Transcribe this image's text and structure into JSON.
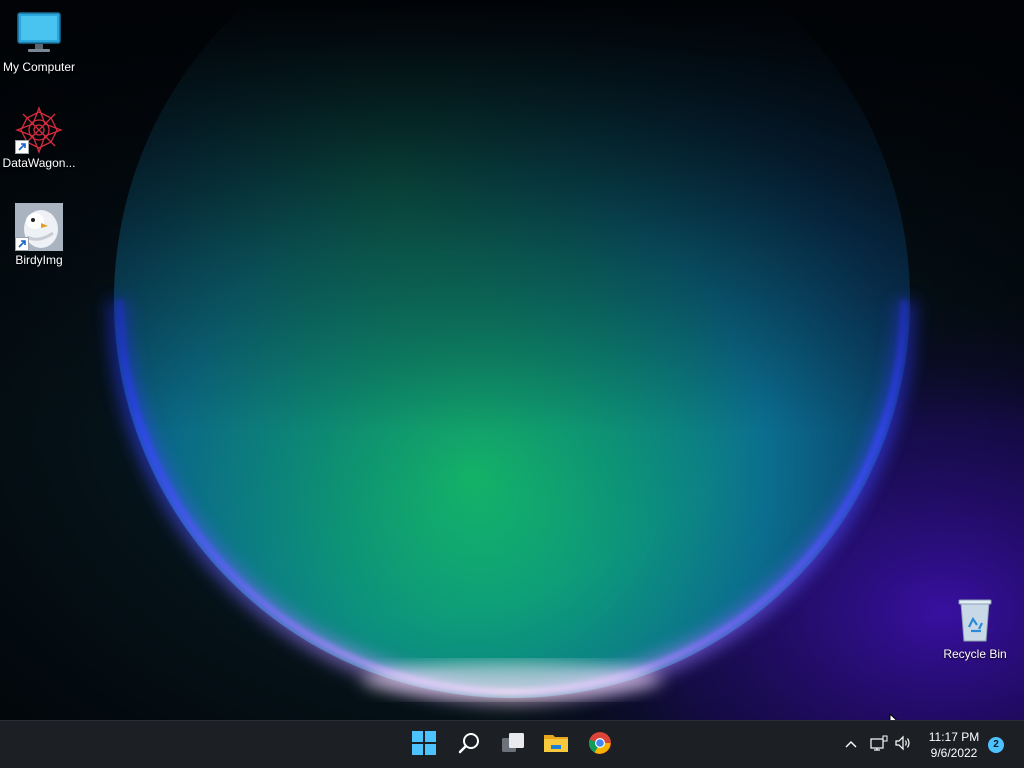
{
  "desktop": {
    "icons": [
      {
        "label": "My Computer",
        "icon": "monitor-icon",
        "shortcut": false
      },
      {
        "label": "DataWagon...",
        "icon": "datawagon-app-icon",
        "shortcut": true
      },
      {
        "label": "BirdyImg",
        "icon": "birdyimg-app-icon",
        "shortcut": true
      },
      {
        "label": "Recycle Bin",
        "icon": "recycle-bin-icon",
        "shortcut": false
      }
    ]
  },
  "taskbar": {
    "buttons": [
      {
        "name": "start",
        "icon": "windows-logo-icon"
      },
      {
        "name": "search",
        "icon": "search-icon"
      },
      {
        "name": "task-view",
        "icon": "task-view-icon"
      },
      {
        "name": "file-explorer",
        "icon": "folder-icon"
      },
      {
        "name": "chrome",
        "icon": "chrome-icon"
      }
    ],
    "tray": {
      "chevron_icon": "chevron-up-icon",
      "network_icon": "network-icon",
      "volume_icon": "volume-icon",
      "time": "11:17 PM",
      "date": "9/6/2022",
      "notification_count": "2"
    }
  },
  "colors": {
    "taskbar_bg": "#1c1f24",
    "accent": "#4cc2ff",
    "notification_badge": "#4cc2ff"
  }
}
